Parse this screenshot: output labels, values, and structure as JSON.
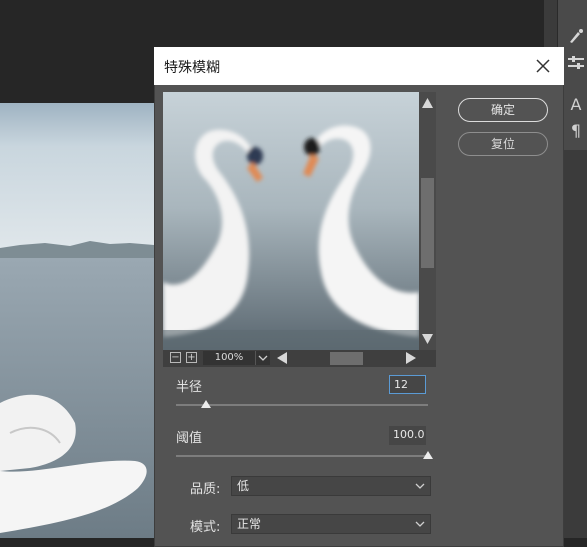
{
  "dialog": {
    "title": "特殊模糊",
    "ok_label": "确定",
    "reset_label": "复位"
  },
  "preview": {
    "zoom": "100%",
    "zoom_out_icon": "minus-box-icon",
    "zoom_in_icon": "plus-box-icon"
  },
  "radius": {
    "label": "半径",
    "value": "12",
    "slider_fraction": 0.12
  },
  "threshold": {
    "label": "阈值",
    "value": "100.0",
    "slider_fraction": 1.0
  },
  "quality": {
    "label": "品质:",
    "selected": "低"
  },
  "mode": {
    "label": "模式:",
    "selected": "正常"
  },
  "colors": {
    "dialog_bg": "#535353",
    "titlebar_bg": "#ffffff",
    "workspace_bg": "#262626"
  },
  "panel_icons": [
    "brush-icon",
    "sliders-icon",
    "type-icon",
    "paragraph-icon"
  ],
  "panel_glyphs": {
    "type": "A",
    "paragraph": "¶"
  }
}
